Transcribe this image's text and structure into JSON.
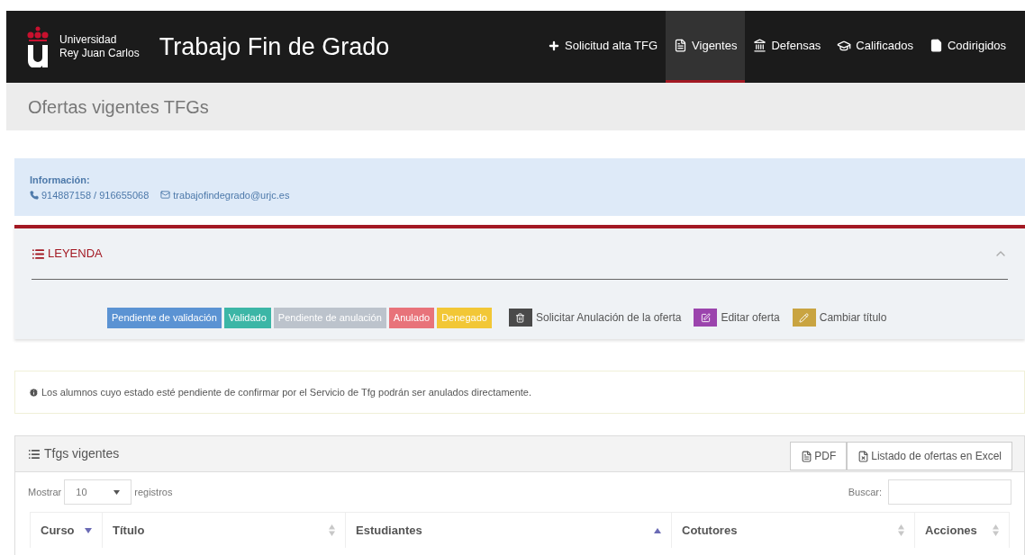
{
  "navbar": {
    "logo_lines": [
      "Universidad",
      "Rey Juan Carlos"
    ],
    "title": "Trabajo Fin de Grado",
    "items": [
      {
        "label": "Solicitud alta TFG",
        "selected": false
      },
      {
        "label": "Vigentes",
        "selected": true
      },
      {
        "label": "Defensas",
        "selected": false
      },
      {
        "label": "Calificados",
        "selected": false
      },
      {
        "label": "Codirigidos",
        "selected": false
      }
    ]
  },
  "page_header": {
    "title": "Ofertas vigentes TFGs"
  },
  "info": {
    "title": "Información:",
    "phone": "914887158 / 916655068",
    "email": "trabajofindegrado@urjc.es"
  },
  "legend": {
    "title": "LEYENDA",
    "expanded": true,
    "badges": [
      {
        "label": "Pendiente de validación",
        "color": "#5b93d3"
      },
      {
        "label": "Validado",
        "color": "#3cb6a6"
      },
      {
        "label": "Pendiente de anulación",
        "color": "#bcc3cc"
      },
      {
        "label": "Anulado",
        "color": "#e8737a"
      },
      {
        "label": "Denegado",
        "color": "#f2c736"
      }
    ],
    "actions": [
      {
        "label": "Solicitar Anulación de la oferta",
        "color": "#4a4a4a"
      },
      {
        "label": "Editar oferta",
        "color": "#9b44ad"
      },
      {
        "label": "Cambiar título",
        "color": "#c9a441"
      }
    ]
  },
  "notice": "Los alumnos cuyo estado esté pendiente de confirmar por el Servicio de Tfg podrán ser anulados directamente.",
  "table_panel": {
    "title": "Tfgs vigentes",
    "buttons": [
      {
        "label": "PDF"
      },
      {
        "label": "Listado de ofertas en Excel"
      }
    ],
    "show_label": "Mostrar",
    "page_size": "10",
    "records_label": "registros",
    "search_label": "Buscar:",
    "columns": [
      {
        "label": "Curso",
        "sorted": true,
        "descending": true
      },
      {
        "label": "Título",
        "sorted": false
      },
      {
        "label": "Estudiantes",
        "sorted": true,
        "descending": false
      },
      {
        "label": "Cotutores",
        "sorted": false
      },
      {
        "label": "Acciones",
        "sorted": false
      }
    ]
  }
}
